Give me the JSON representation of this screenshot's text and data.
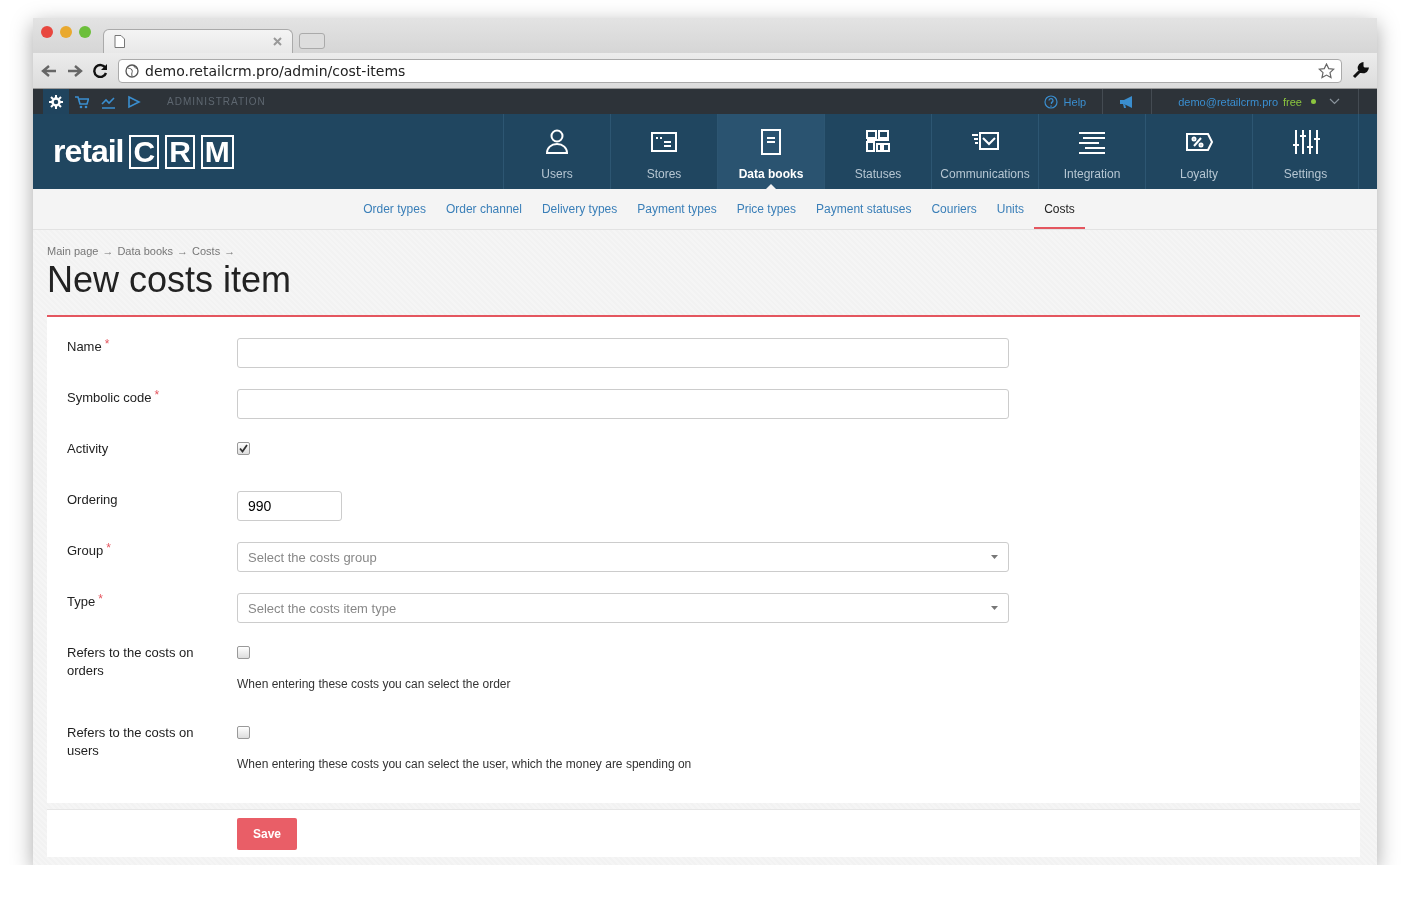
{
  "browser": {
    "url": "demo.retailcrm.pro/admin/cost-items"
  },
  "admin_bar": {
    "section": "ADMINISTRATION",
    "icons": [
      {
        "kind": "gear",
        "selected": true
      },
      {
        "kind": "cart",
        "selected": false
      },
      {
        "kind": "chart",
        "selected": false
      },
      {
        "kind": "play",
        "selected": false
      }
    ],
    "help": "Help",
    "email": "demo@retailcrm.pro",
    "plan": "free"
  },
  "logo": {
    "word": "retail",
    "letters": [
      "C",
      "R",
      "M"
    ]
  },
  "main_nav": [
    {
      "label": "Users",
      "kind": "user",
      "selected": false
    },
    {
      "label": "Stores",
      "kind": "store",
      "selected": false
    },
    {
      "label": "Data books",
      "kind": "book",
      "selected": true
    },
    {
      "label": "Statuses",
      "kind": "grid",
      "selected": false
    },
    {
      "label": "Communications",
      "kind": "mail",
      "selected": false
    },
    {
      "label": "Integration",
      "kind": "lines",
      "selected": false
    },
    {
      "label": "Loyalty",
      "kind": "percent",
      "selected": false
    },
    {
      "label": "Settings",
      "kind": "sliders",
      "selected": false
    }
  ],
  "sub_nav": [
    {
      "label": "Order types",
      "selected": false
    },
    {
      "label": "Order channel",
      "selected": false
    },
    {
      "label": "Delivery types",
      "selected": false
    },
    {
      "label": "Payment types",
      "selected": false
    },
    {
      "label": "Price types",
      "selected": false
    },
    {
      "label": "Payment statuses",
      "selected": false
    },
    {
      "label": "Couriers",
      "selected": false
    },
    {
      "label": "Units",
      "selected": false
    },
    {
      "label": "Costs",
      "selected": true
    }
  ],
  "breadcrumbs": {
    "items": [
      "Main page",
      "Data books",
      "Costs"
    ],
    "separator": "→"
  },
  "title": "New costs item",
  "fields": [
    {
      "kind": "text",
      "label": "Name",
      "required": true
    },
    {
      "kind": "text",
      "label": "Symbolic code",
      "required": true
    },
    {
      "kind": "checkbox",
      "label": "Activity",
      "required": false,
      "checked": true
    },
    {
      "kind": "number",
      "label": "Ordering",
      "required": false,
      "value": "990"
    },
    {
      "kind": "select",
      "label": "Group",
      "required": true,
      "placeholder": "Select the costs group"
    },
    {
      "kind": "select",
      "label": "Type",
      "required": true,
      "placeholder": "Select the costs item type"
    },
    {
      "kind": "checkbox",
      "label": "Refers to the costs on orders",
      "required": false,
      "checked": false,
      "hint": "When entering these costs you can select the order"
    },
    {
      "kind": "checkbox",
      "label": "Refers to the costs on users",
      "required": false,
      "checked": false,
      "hint": "When entering these costs you can select the user, which the money are spending on"
    }
  ],
  "required_mark": "*",
  "save": "Save"
}
